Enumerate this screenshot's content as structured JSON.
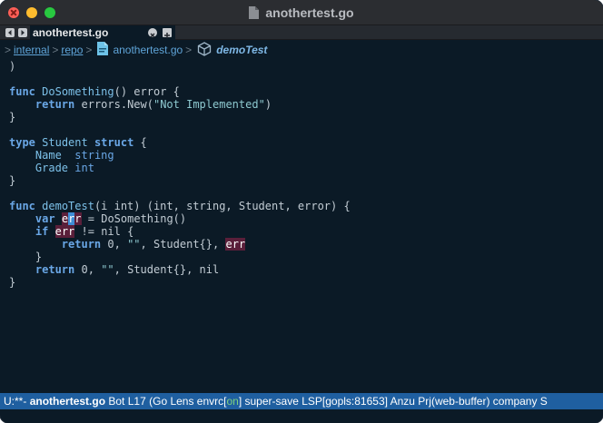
{
  "window": {
    "title": "anothertest.go"
  },
  "tabs": [
    {
      "label": "anothertest.go",
      "active": true
    }
  ],
  "breadcrumb": {
    "items": [
      "internal",
      "repo"
    ],
    "file": "anothertest.go",
    "symbol": "demoTest",
    "separator": ">"
  },
  "code": {
    "line_1": ")",
    "line_3_kw": "func",
    "line_3_fn": "DoSomething",
    "line_3_rest": "() error {",
    "line_4_kw": "return",
    "line_4_a": "errors.New(",
    "line_4_str": "\"Not Implemented\"",
    "line_4_b": ")",
    "line_5": "}",
    "line_7_kw": "type",
    "line_7_name": "Student",
    "line_7_kw2": "struct",
    "line_7_rest": "{",
    "line_8_fld": "Name",
    "line_8_ty": "string",
    "line_9_fld": "Grade",
    "line_9_ty": "int",
    "line_10": "}",
    "line_12_kw": "func",
    "line_12_fn": "demoTest",
    "line_12_rest": "(i int) (int, string, Student, error) {",
    "line_13_kw": "var",
    "line_13_e": "e",
    "line_13_cur": "r",
    "line_13_r": "r",
    "line_13_rest": "= DoSomething()",
    "line_14_kw": "if",
    "line_14_hl": "err",
    "line_14_rest": "!= nil {",
    "line_15_kw": "return",
    "line_15_a": "0,",
    "line_15_str": "\"\"",
    "line_15_b": ", Student{},",
    "line_15_hl": "err",
    "line_16": "}",
    "line_17_kw": "return",
    "line_17_a": "0,",
    "line_17_str": "\"\"",
    "line_17_b": ", Student{}, nil",
    "line_18": "}"
  },
  "modeline": {
    "state": "U:**-",
    "file": "anothertest.go",
    "position": "Bot",
    "line": "L17",
    "modes_a": "(Go Lens envrc[",
    "modes_on": "on",
    "modes_b": "] super-save LSP[gopls:81653] Anzu Prj(web-buffer) company S"
  },
  "colors": {
    "background": "#0b1a26",
    "keyword": "#6aa7e6",
    "function": "#7cc0e8",
    "modeline": "#1f5fa0",
    "highlight": "#5a1f3a"
  }
}
